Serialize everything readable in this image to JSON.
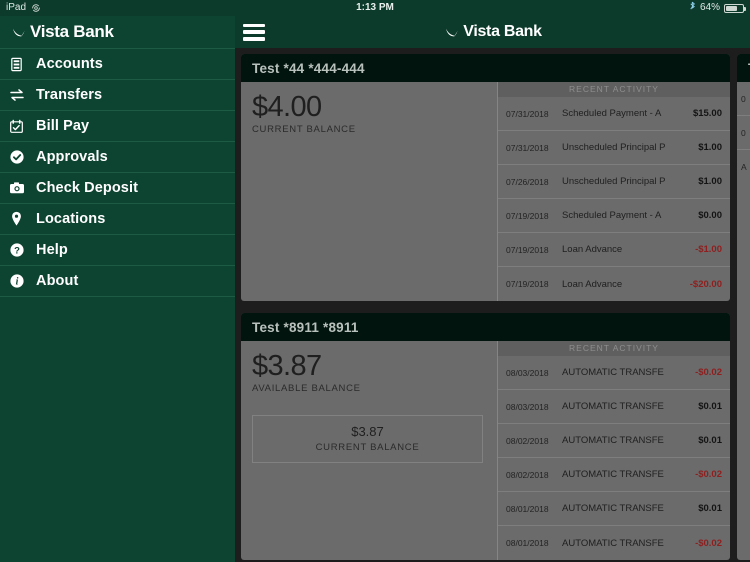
{
  "status_bar": {
    "device": "iPad",
    "rotation_lock_icon": "rotation-lock-icon",
    "time": "1:13 PM",
    "bluetooth_icon": "bluetooth-icon",
    "battery_percent": "64%",
    "battery_icon": "battery-icon"
  },
  "sidebar": {
    "brand": "Vista Bank",
    "logo_icon": "vista-bank-logo-icon",
    "items": [
      {
        "label": "Accounts",
        "icon": "accounts-icon"
      },
      {
        "label": "Transfers",
        "icon": "transfers-icon"
      },
      {
        "label": "Bill Pay",
        "icon": "bill-pay-calendar-icon"
      },
      {
        "label": "Approvals",
        "icon": "approvals-check-icon"
      },
      {
        "label": "Check Deposit",
        "icon": "camera-icon"
      },
      {
        "label": "Locations",
        "icon": "map-pin-icon"
      },
      {
        "label": "Help",
        "icon": "question-mark-icon"
      },
      {
        "label": "About",
        "icon": "info-icon"
      }
    ]
  },
  "topbar": {
    "menu_icon": "hamburger-menu-icon",
    "brand": "Vista Bank",
    "logo_icon": "vista-bank-logo-icon"
  },
  "accounts": [
    {
      "title": "Test *44 *444-444",
      "balance_amount": "$4.00",
      "balance_label": "CURRENT BALANCE",
      "activity_header": "RECENT ACTIVITY",
      "transactions": [
        {
          "date": "07/31/2018",
          "description": "Scheduled Payment - A",
          "amount": "$15.00",
          "negative": false
        },
        {
          "date": "07/31/2018",
          "description": "Unscheduled Principal P",
          "amount": "$1.00",
          "negative": false
        },
        {
          "date": "07/26/2018",
          "description": "Unscheduled Principal P",
          "amount": "$1.00",
          "negative": false
        },
        {
          "date": "07/19/2018",
          "description": "Scheduled Payment - A",
          "amount": "$0.00",
          "negative": false
        },
        {
          "date": "07/19/2018",
          "description": "Loan Advance",
          "amount": "-$1.00",
          "negative": true
        },
        {
          "date": "07/19/2018",
          "description": "Loan Advance",
          "amount": "-$20.00",
          "negative": true
        }
      ]
    },
    {
      "title": "Test *8911 *8911",
      "balance_amount": "$3.87",
      "balance_label": "AVAILABLE BALANCE",
      "sub_amount": "$3.87",
      "sub_label": "CURRENT BALANCE",
      "activity_header": "RECENT ACTIVITY",
      "transactions": [
        {
          "date": "08/03/2018",
          "description": "AUTOMATIC TRANSFE",
          "amount": "-$0.02",
          "negative": true
        },
        {
          "date": "08/03/2018",
          "description": "AUTOMATIC TRANSFE",
          "amount": "$0.01",
          "negative": false
        },
        {
          "date": "08/02/2018",
          "description": "AUTOMATIC TRANSFE",
          "amount": "$0.01",
          "negative": false
        },
        {
          "date": "08/02/2018",
          "description": "AUTOMATIC TRANSFE",
          "amount": "-$0.02",
          "negative": true
        },
        {
          "date": "08/01/2018",
          "description": "AUTOMATIC TRANSFE",
          "amount": "$0.01",
          "negative": false
        },
        {
          "date": "08/01/2018",
          "description": "AUTOMATIC TRANSFE",
          "amount": "-$0.02",
          "negative": true
        }
      ]
    }
  ],
  "partial_account": {
    "title": "T",
    "transactions": [
      {
        "date": "0",
        "description": "",
        "amount": ""
      },
      {
        "date": "0",
        "description": "",
        "amount": ""
      },
      {
        "date": "A",
        "description": "",
        "amount": ""
      }
    ]
  },
  "colors": {
    "brand_green": "#0d4431",
    "header_green": "#0d3b2b",
    "card_header": "#02140e",
    "dimmed_card": "#6b6b6b",
    "negative_amount": "#8f1f1f",
    "page_background": "#1d1d1d"
  }
}
